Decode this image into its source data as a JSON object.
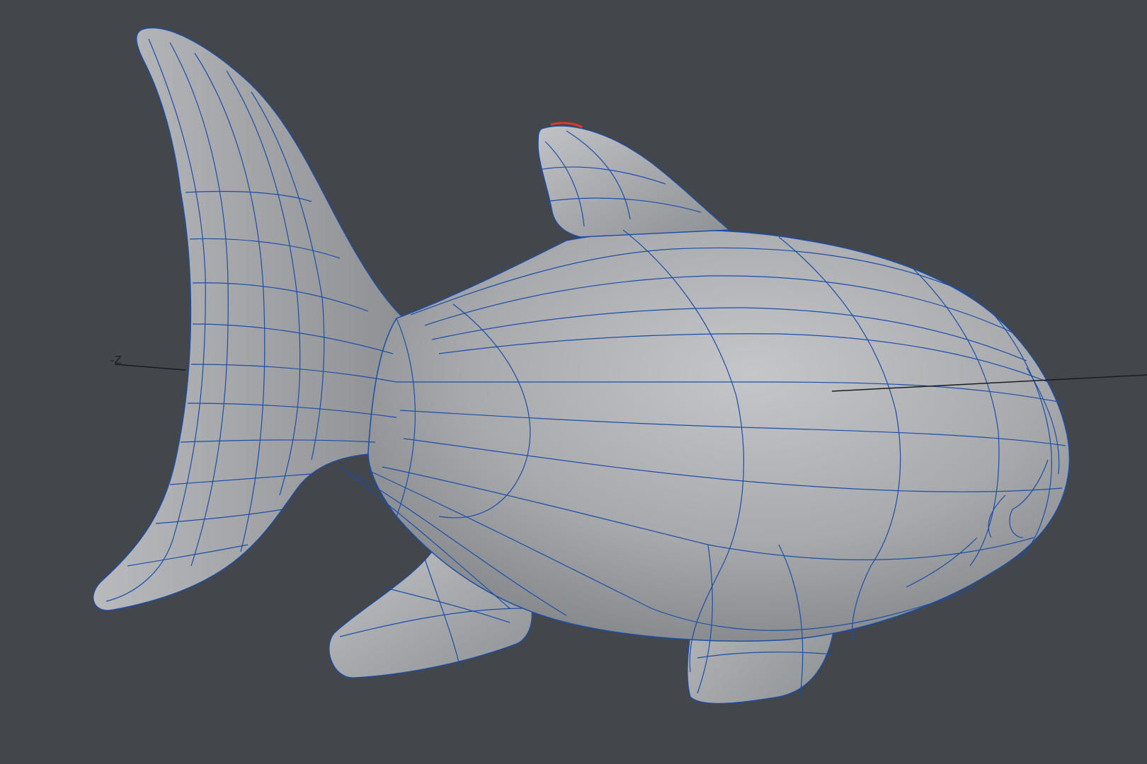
{
  "viewport": {
    "background": "#43474c",
    "axis_label": "-Z"
  },
  "model": {
    "shape": "shark-icon",
    "surface_color": "#a9abae",
    "wire_color": "#1b4ea8",
    "selection_color": "#e0392b"
  }
}
